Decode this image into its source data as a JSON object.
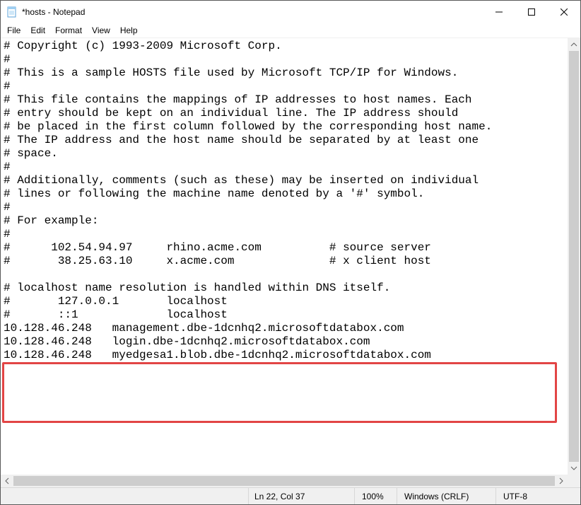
{
  "window": {
    "title": "*hosts - Notepad"
  },
  "menu": {
    "file": "File",
    "edit": "Edit",
    "format": "Format",
    "view": "View",
    "help": "Help"
  },
  "content": {
    "lines": [
      "# Copyright (c) 1993-2009 Microsoft Corp.",
      "#",
      "# This is a sample HOSTS file used by Microsoft TCP/IP for Windows.",
      "#",
      "# This file contains the mappings of IP addresses to host names. Each",
      "# entry should be kept on an individual line. The IP address should",
      "# be placed in the first column followed by the corresponding host name.",
      "# The IP address and the host name should be separated by at least one",
      "# space.",
      "#",
      "# Additionally, comments (such as these) may be inserted on individual",
      "# lines or following the machine name denoted by a '#' symbol.",
      "#",
      "# For example:",
      "#",
      "#      102.54.94.97     rhino.acme.com          # source server",
      "#       38.25.63.10     x.acme.com              # x client host",
      "",
      "# localhost name resolution is handled within DNS itself.",
      "#       127.0.0.1       localhost",
      "#       ::1             localhost",
      "10.128.46.248   management.dbe-1dcnhq2.microsoftdatabox.com",
      "10.128.46.248   login.dbe-1dcnhq2.microsoftdatabox.com",
      "10.128.46.248   myedgesa1.blob.dbe-1dcnhq2.microsoftdatabox.com",
      ""
    ]
  },
  "status": {
    "position": "Ln 22, Col 37",
    "zoom": "100%",
    "eol": "Windows (CRLF)",
    "encoding": "UTF-8"
  }
}
